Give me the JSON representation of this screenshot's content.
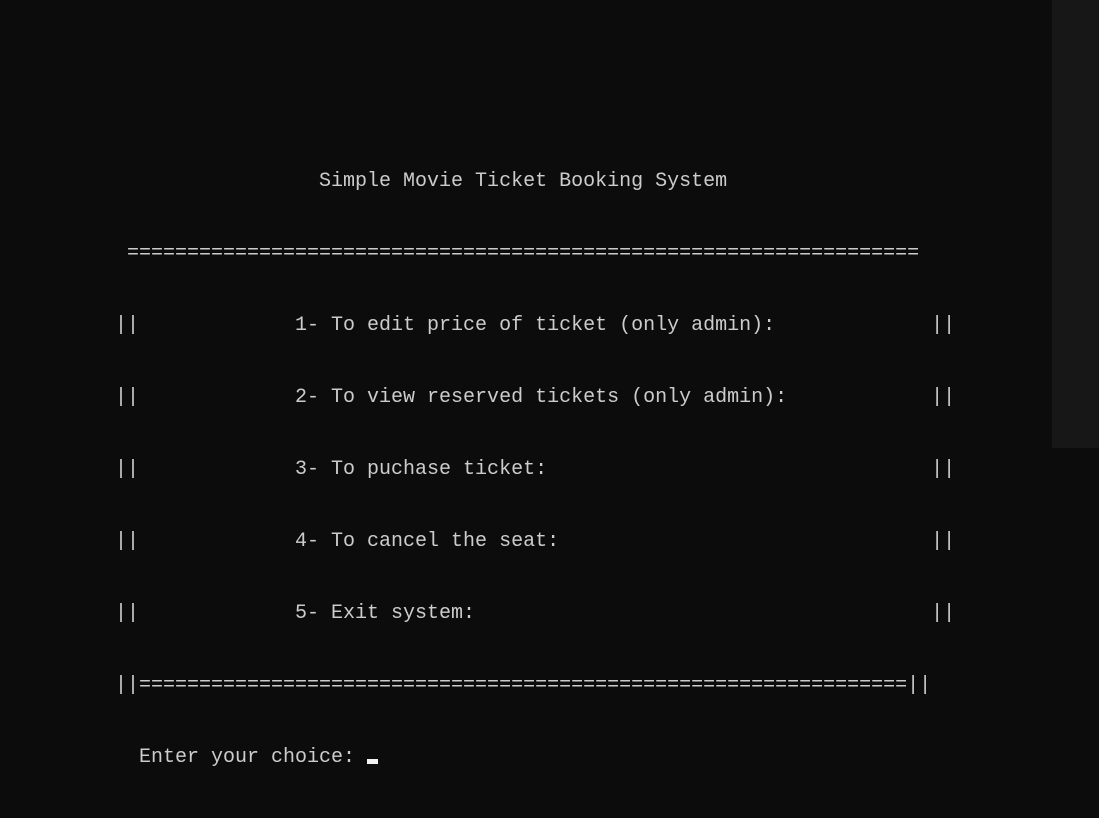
{
  "console": {
    "title_line": "                 Simple Movie Ticket Booking System",
    "top_border": " ==================================================================",
    "menu_lines": [
      "||             1- To edit price of ticket (only admin):             ||",
      "||             2- To view reserved tickets (only admin):            ||",
      "||             3- To puchase ticket:                                ||",
      "||             4- To cancel the seat:                               ||",
      "||             5- Exit system:                                      ||"
    ],
    "bottom_border": "||================================================================||",
    "prompt": "  Enter your choice: "
  }
}
